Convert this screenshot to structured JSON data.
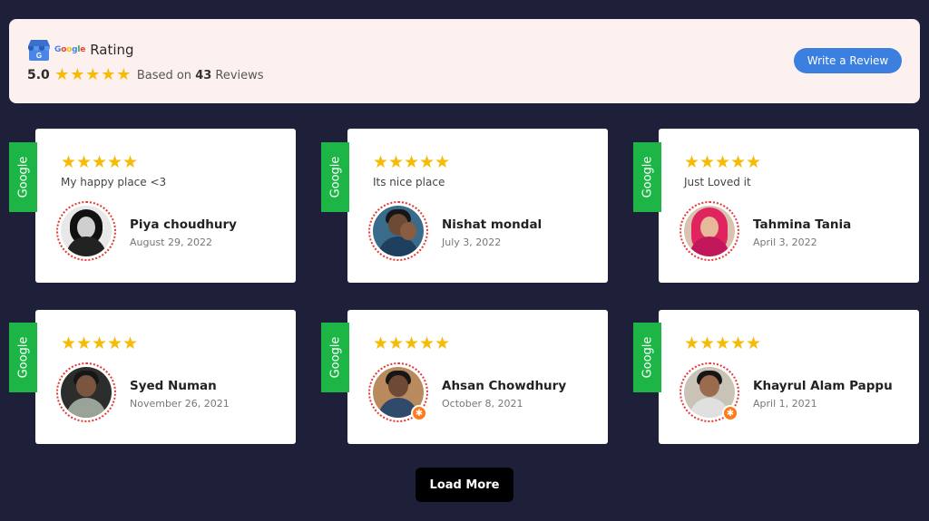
{
  "header": {
    "google_word": "Google",
    "title": "Rating",
    "score": "5.0",
    "star_count": 5,
    "based_prefix": "Based on",
    "review_count": "43",
    "based_suffix": "Reviews",
    "write_button": "Write a Review",
    "icon": "google-my-business-store-icon"
  },
  "colors": {
    "page_bg": "#1e1f38",
    "header_bg": "#fdf1f0",
    "star": "#f6bb06",
    "ribbon": "#1eb547",
    "write_button": "#3b7fe0",
    "load_button": "#000000",
    "avatar_ring": "#e53935"
  },
  "reviews": [
    {
      "source": "Google",
      "rating": 5,
      "text": "My happy place <3",
      "name": "Piya choudhury",
      "date": "August 29, 2022"
    },
    {
      "source": "Google",
      "rating": 5,
      "text": "Its nice place",
      "name": "Nishat mondal",
      "date": "July 3, 2022"
    },
    {
      "source": "Google",
      "rating": 5,
      "text": "Just Loved it",
      "name": "Tahmina Tania",
      "date": "April 3, 2022"
    },
    {
      "source": "Google",
      "rating": 5,
      "text": "",
      "name": "Syed Numan",
      "date": "November 26, 2021"
    },
    {
      "source": "Google",
      "rating": 5,
      "text": "",
      "name": "Ahsan Chowdhury",
      "date": "October 8, 2021"
    },
    {
      "source": "Google",
      "rating": 5,
      "text": "",
      "name": "Khayrul Alam Pappu",
      "date": "April 1, 2021"
    }
  ],
  "load_more": "Load More"
}
